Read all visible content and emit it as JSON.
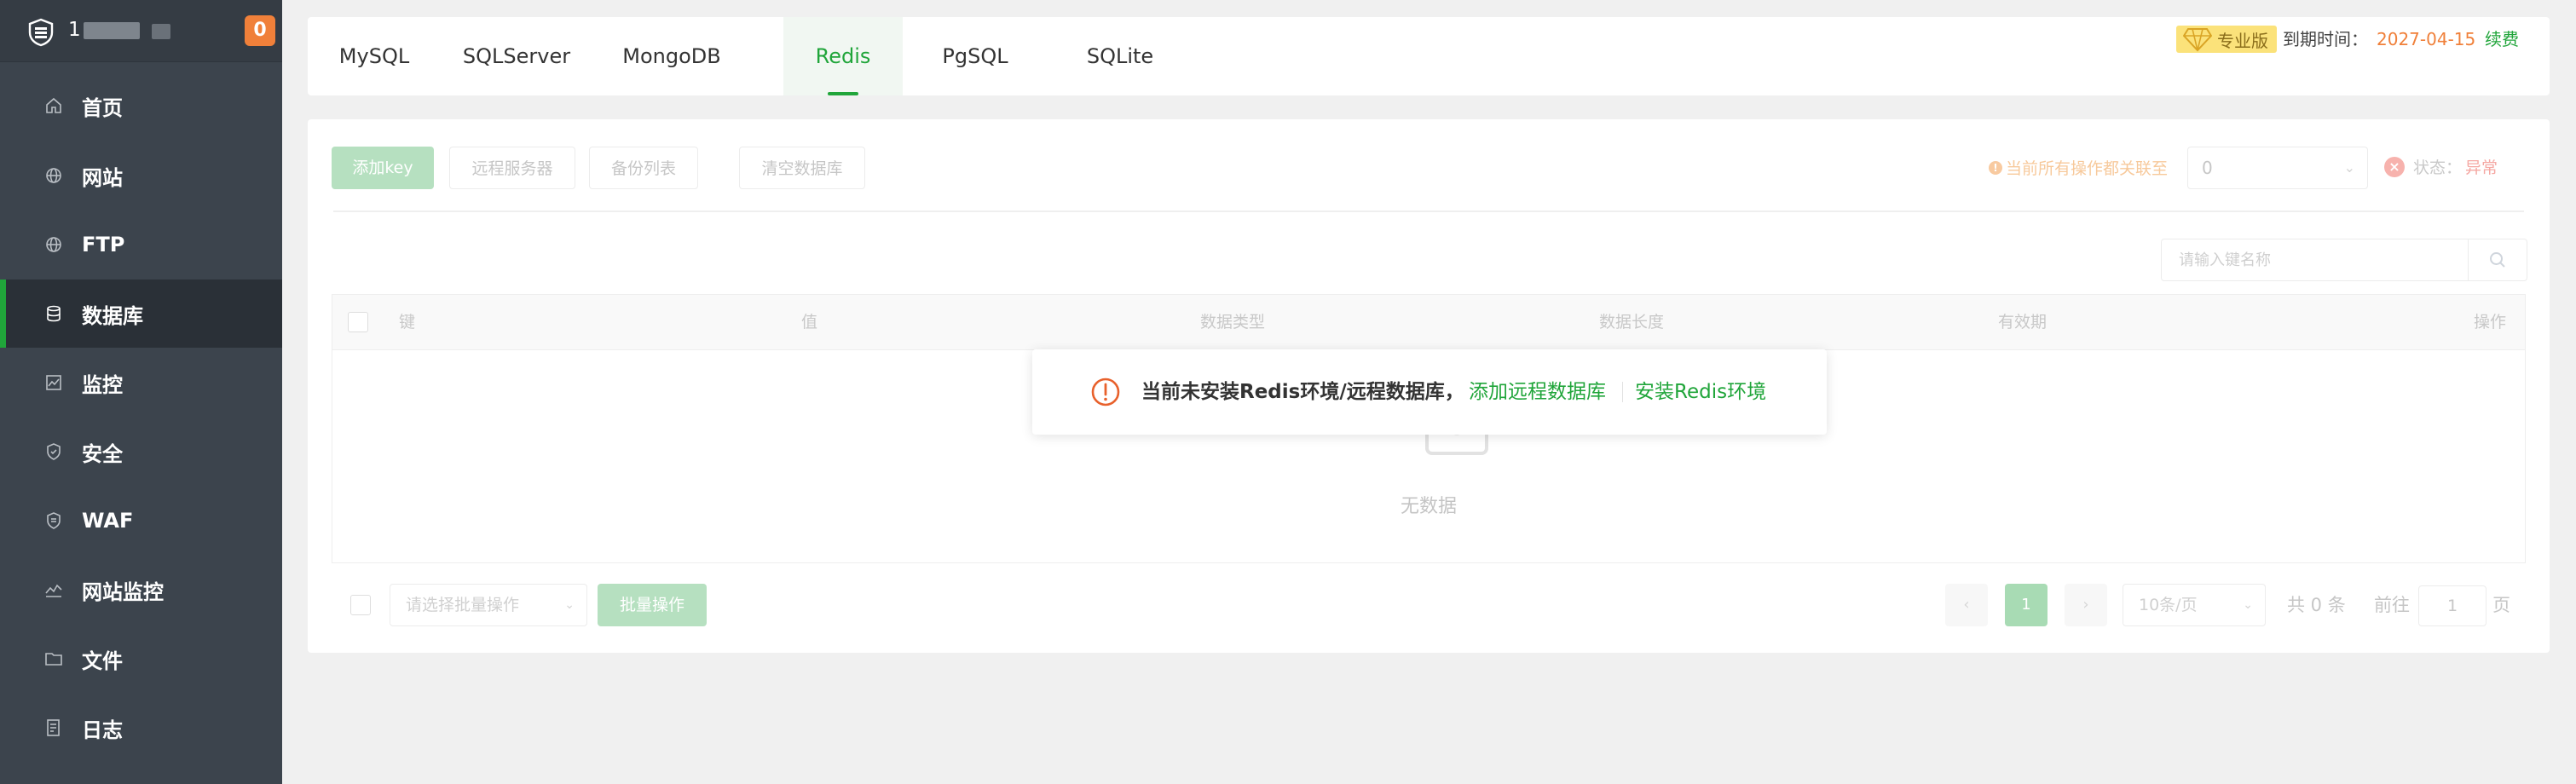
{
  "sidebar": {
    "server_name": "1",
    "badge_count": "0",
    "items": [
      {
        "label": "首页",
        "icon": "home-icon"
      },
      {
        "label": "网站",
        "icon": "globe-icon"
      },
      {
        "label": "FTP",
        "icon": "globe-icon"
      },
      {
        "label": "数据库",
        "icon": "database-icon",
        "active": true
      },
      {
        "label": "监控",
        "icon": "monitor-chart-icon"
      },
      {
        "label": "安全",
        "icon": "shield-icon"
      },
      {
        "label": "WAF",
        "icon": "waf-shield-icon"
      },
      {
        "label": "网站监控",
        "icon": "line-chart-icon"
      },
      {
        "label": "文件",
        "icon": "folder-icon"
      },
      {
        "label": "日志",
        "icon": "log-icon"
      }
    ]
  },
  "tabs": {
    "items": [
      "MySQL",
      "SQLServer",
      "MongoDB",
      "Redis",
      "PgSQL",
      "SQLite"
    ],
    "active": "Redis"
  },
  "license": {
    "edition": "专业版",
    "expire_label": "到期时间：",
    "expire_date": "2027-04-15",
    "renew_label": "续费"
  },
  "toolbar": {
    "add_key": "添加key",
    "remote_server": "远程服务器",
    "backup_list": "备份列表",
    "clear_db": "清空数据库",
    "tip": "当前所有操作都关联至",
    "db_selected": "0",
    "status_label": "状态：",
    "status_value": "异常"
  },
  "search": {
    "placeholder": "请输入键名称"
  },
  "table": {
    "columns": [
      "键",
      "值",
      "数据类型",
      "数据长度",
      "有效期",
      "操作"
    ],
    "empty_text": "无数据"
  },
  "footer": {
    "batch_placeholder": "请选择批量操作",
    "batch_button": "批量操作",
    "current_page": "1",
    "page_size": "10条/页",
    "total": "共 0 条",
    "goto_prefix": "前往",
    "goto_value": "1",
    "goto_suffix": "页"
  },
  "message": {
    "text": "当前未安装Redis环境/远程数据库，",
    "link_remote": "添加远程数据库",
    "link_install": "安装Redis环境"
  },
  "colors": {
    "accent": "#20a53a",
    "sidebar_bg": "#3c444d",
    "warning": "#f0803a"
  }
}
